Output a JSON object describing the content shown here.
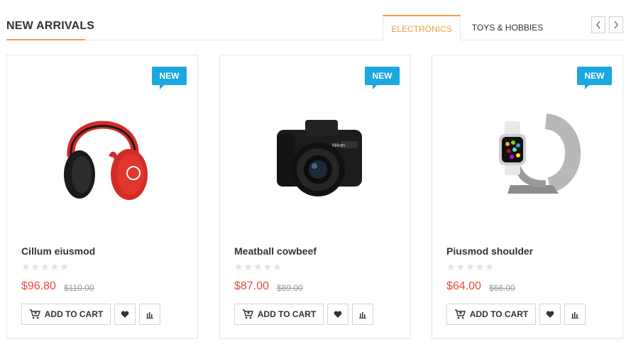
{
  "section": {
    "title": "NEW ARRIVALS",
    "accent_color": "#f39c44"
  },
  "tabs": [
    {
      "label": "ELECTRONICS",
      "active": true
    },
    {
      "label": "TOYS & HOBBIES",
      "active": false
    }
  ],
  "nav": {
    "prev_icon": "chevron-left-icon",
    "next_icon": "chevron-right-icon"
  },
  "products": [
    {
      "badge": "NEW",
      "image": "red-headphones",
      "name": "Cillum eiusmod",
      "rating": 0,
      "stars": "★★★★★",
      "price": "$96.80",
      "old_price": "$110.00",
      "add_to_cart": "ADD TO CART"
    },
    {
      "badge": "NEW",
      "image": "dslr-camera",
      "name": "Meatball cowbeef",
      "rating": 0,
      "stars": "★★★★★",
      "price": "$87.00",
      "old_price": "$89.00",
      "add_to_cart": "ADD TO CART"
    },
    {
      "badge": "NEW",
      "image": "smartwatch-on-stand",
      "name": "Piusmod shoulder",
      "rating": 0,
      "stars": "★★★★★",
      "price": "$64.00",
      "old_price": "$66.00",
      "add_to_cart": "ADD TO CART"
    }
  ],
  "colors": {
    "badge": "#1aa7e2",
    "price": "#e94a3c",
    "accent": "#f39c44"
  }
}
